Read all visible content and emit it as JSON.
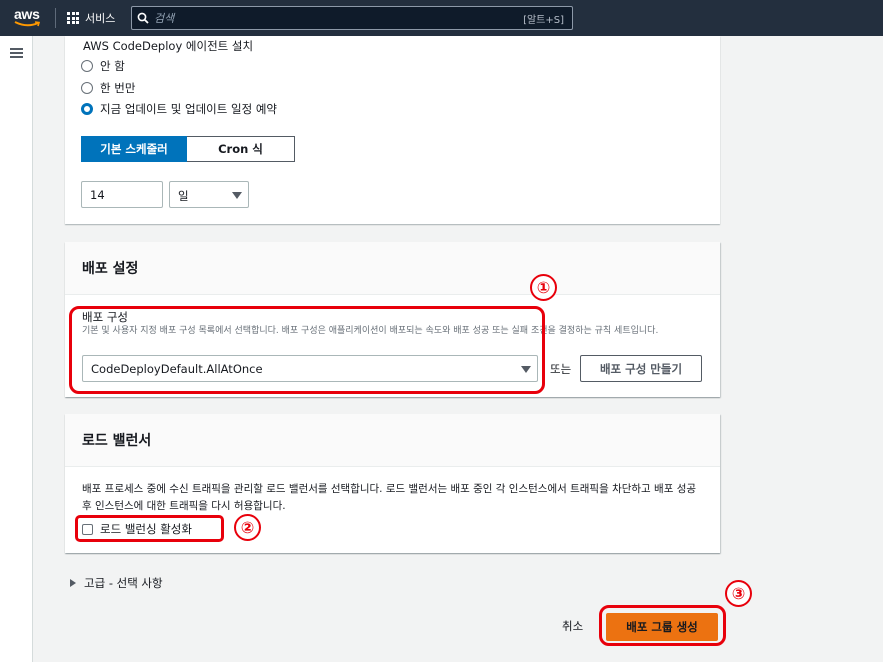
{
  "nav": {
    "logo": "aws",
    "services_label": "서비스",
    "search_placeholder": "검색",
    "search_shortcut": "[알트+S]"
  },
  "agent": {
    "label": "AWS CodeDeploy 에이전트 설치",
    "options": [
      "안 함",
      "한 번만",
      "지금 업데이트 및 업데이트 일정 예약"
    ],
    "selected_index": 2,
    "scheduler_tabs": [
      "기본 스케줄러",
      "Cron 식"
    ],
    "interval_value": "14",
    "interval_unit": "일"
  },
  "deploy_settings": {
    "title": "배포 설정",
    "config_label": "배포 구성",
    "config_desc": "기본 및 사용자 지정 배포 구성 목록에서 선택합니다. 배포 구성은 애플리케이션이 배포되는 속도와 배포 성공 또는 실패 조건을 결정하는 규칙 세트입니다.",
    "config_value": "CodeDeployDefault.AllAtOnce",
    "or_text": "또는",
    "create_button": "배포 구성 만들기"
  },
  "load_balancer": {
    "title": "로드 밸런서",
    "desc": "배포 프로세스 중에 수신 트래픽을 관리할 로드 밸런서를 선택합니다. 로드 밸런서는 배포 중인 각 인스턴스에서 트래픽을 차단하고 배포 성공 후 인스턴스에 대한 트래픽을 다시 허용합니다.",
    "enable_label": "로드 밸런싱 활성화",
    "enabled": false
  },
  "advanced": {
    "label": "고급 - 선택 사항"
  },
  "footer": {
    "cancel": "취소",
    "create": "배포 그룹 생성"
  },
  "annotations": {
    "markers": [
      "①",
      "②",
      "③"
    ],
    "color": "#e8000b"
  },
  "colors": {
    "nav_bg": "#232f3e",
    "primary": "#ec7211",
    "selected_blue": "#0073bb"
  }
}
